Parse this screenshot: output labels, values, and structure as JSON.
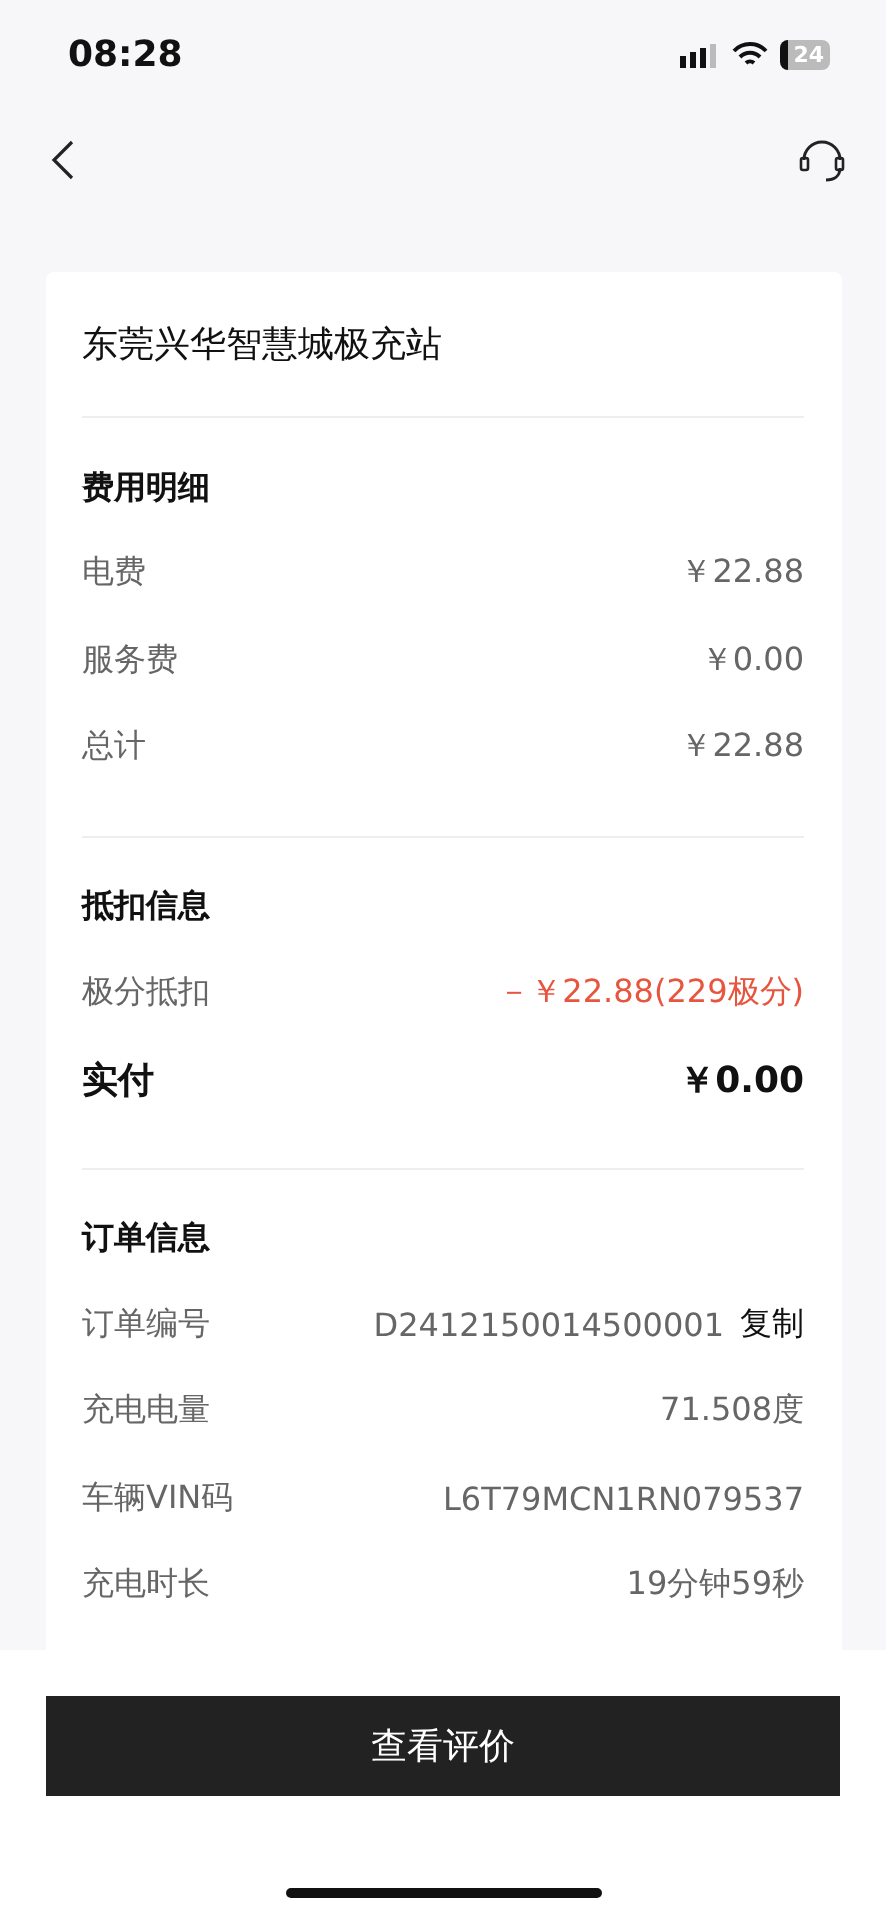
{
  "status_bar": {
    "time": "08:28",
    "battery": "24"
  },
  "station": {
    "name": "东莞兴华智慧城极充站"
  },
  "sections": [
    {
      "title": "费用明细",
      "rows": [
        {
          "kind": "plain",
          "label": "电费",
          "value": "￥22.88"
        },
        {
          "kind": "plain",
          "label": "服务费",
          "value": "￥0.00"
        },
        {
          "kind": "plain",
          "label": "总计",
          "value": "￥22.88"
        }
      ]
    },
    {
      "title": "抵扣信息",
      "rows": [
        {
          "kind": "deduction",
          "label": "极分抵扣",
          "value": "－￥22.88(229极分)"
        },
        {
          "kind": "total",
          "label": "实付",
          "value": "￥0.00"
        }
      ]
    },
    {
      "title": "订单信息",
      "rows": [
        {
          "kind": "copy",
          "label": "订单编号",
          "value": "D2412150014500001",
          "action": "复制"
        },
        {
          "kind": "plain",
          "label": "充电电量",
          "value": "71.508度"
        },
        {
          "kind": "plain",
          "label": "车辆VIN码",
          "value": "L6T79MCN1RN079537"
        },
        {
          "kind": "plain",
          "label": "充电时长",
          "value": "19分钟59秒"
        }
      ]
    }
  ],
  "primary_button": {
    "label": "查看评价"
  }
}
